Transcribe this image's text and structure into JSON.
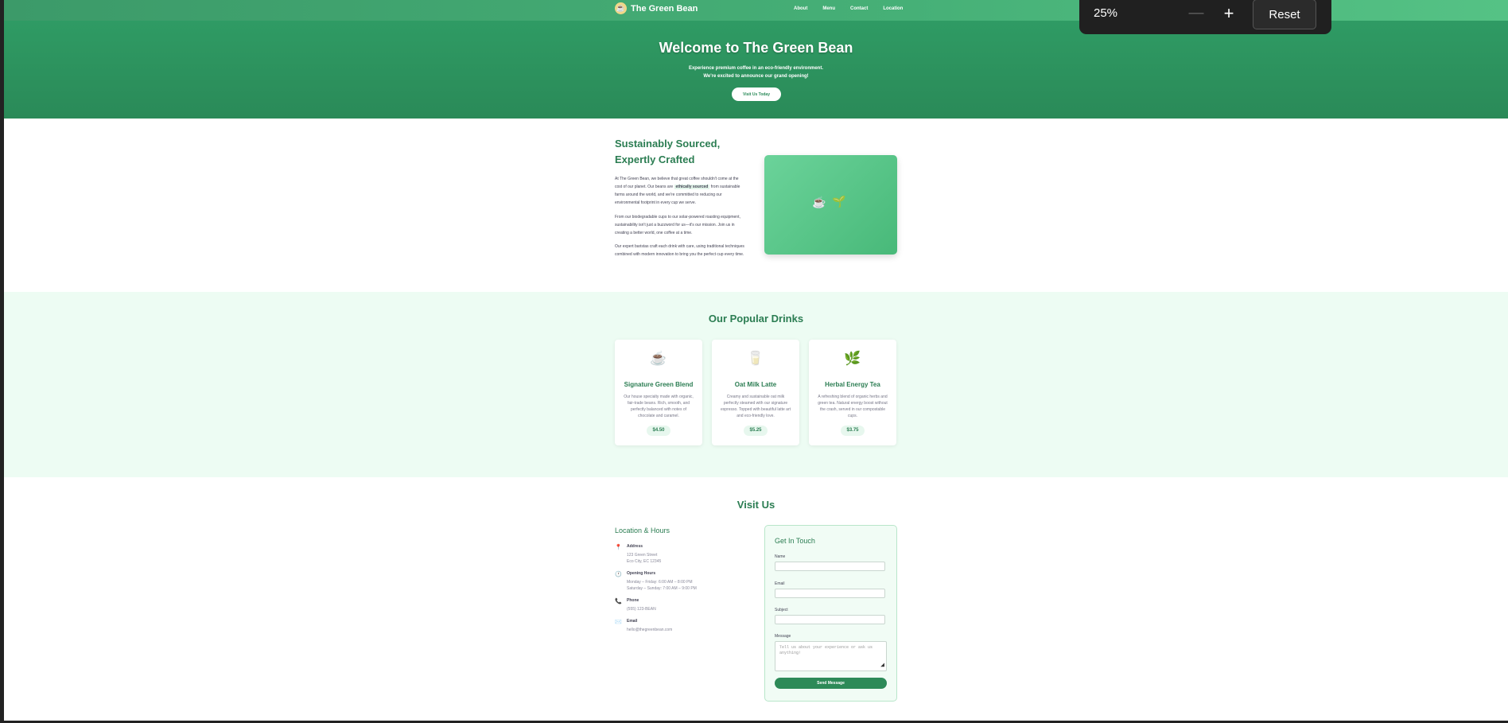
{
  "header": {
    "logo_text": "The Green Bean",
    "nav": [
      "About",
      "Menu",
      "Contact",
      "Location"
    ]
  },
  "hero": {
    "title": "Welcome to The Green Bean",
    "subtitle_line1": "Experience premium coffee in an eco-friendly environment.",
    "subtitle_line2": "We're excited to announce our grand opening!",
    "cta": "Visit Us Today"
  },
  "about": {
    "title_line1": "Sustainably Sourced,",
    "title_line2": "Expertly Crafted",
    "p1_before": "At The Green Bean, we believe that great coffee shouldn't come at the cost of our planet. Our beans are",
    "p1_highlight": "ethically sourced",
    "p1_after": "from sustainable farms around the world, and we're committed to reducing our environmental footprint in every cup we serve.",
    "p2": "From our biodegradable cups to our solar-powered roasting equipment, sustainability isn't just a buzzword for us—it's our mission. Join us in creating a better world, one coffee at a time.",
    "p3": "Our expert baristas craft each drink with care, using traditional techniques combined with modern innovation to bring you the perfect cup every time."
  },
  "drinks": {
    "title": "Our Popular Drinks",
    "items": [
      {
        "icon": "☕",
        "name": "Signature Green Blend",
        "desc": "Our house specialty made with organic, fair-trade beans. Rich, smooth, and perfectly balanced with notes of chocolate and caramel.",
        "price": "$4.50"
      },
      {
        "icon": "🥛",
        "name": "Oat Milk Latte",
        "desc": "Creamy and sustainable oat milk perfectly steamed with our signature espresso. Topped with beautiful latte art and eco-friendly love.",
        "price": "$5.25"
      },
      {
        "icon": "🌿",
        "name": "Herbal Energy Tea",
        "desc": "A refreshing blend of organic herbs and green tea. Natural energy boost without the crash, served in our compostable cups.",
        "price": "$3.75"
      }
    ]
  },
  "visit": {
    "title": "Visit Us",
    "location_title": "Location & Hours",
    "info": [
      {
        "icon": "📍",
        "label": "Address",
        "line1": "123 Green Street",
        "line2": "Eco City, EC 12345"
      },
      {
        "icon": "🕐",
        "label": "Opening Hours",
        "line1": "Monday – Friday: 6:00 AM – 8:00 PM",
        "line2": "Saturday – Sunday: 7:00 AM – 9:00 PM"
      },
      {
        "icon": "📞",
        "label": "Phone",
        "line1": "(555) 123-BEAN",
        "line2": ""
      },
      {
        "icon": "✉️",
        "label": "Email",
        "line1": "hello@thegreenbean.com",
        "line2": ""
      }
    ],
    "form": {
      "title": "Get In Touch",
      "name_label": "Name",
      "email_label": "Email",
      "subject_label": "Subject",
      "message_label": "Message",
      "message_placeholder": "Tell us about your experience or ask us anything!",
      "send": "Send Message"
    }
  },
  "zoom": {
    "level": "25%",
    "minus": "—",
    "plus": "+",
    "reset": "Reset"
  }
}
